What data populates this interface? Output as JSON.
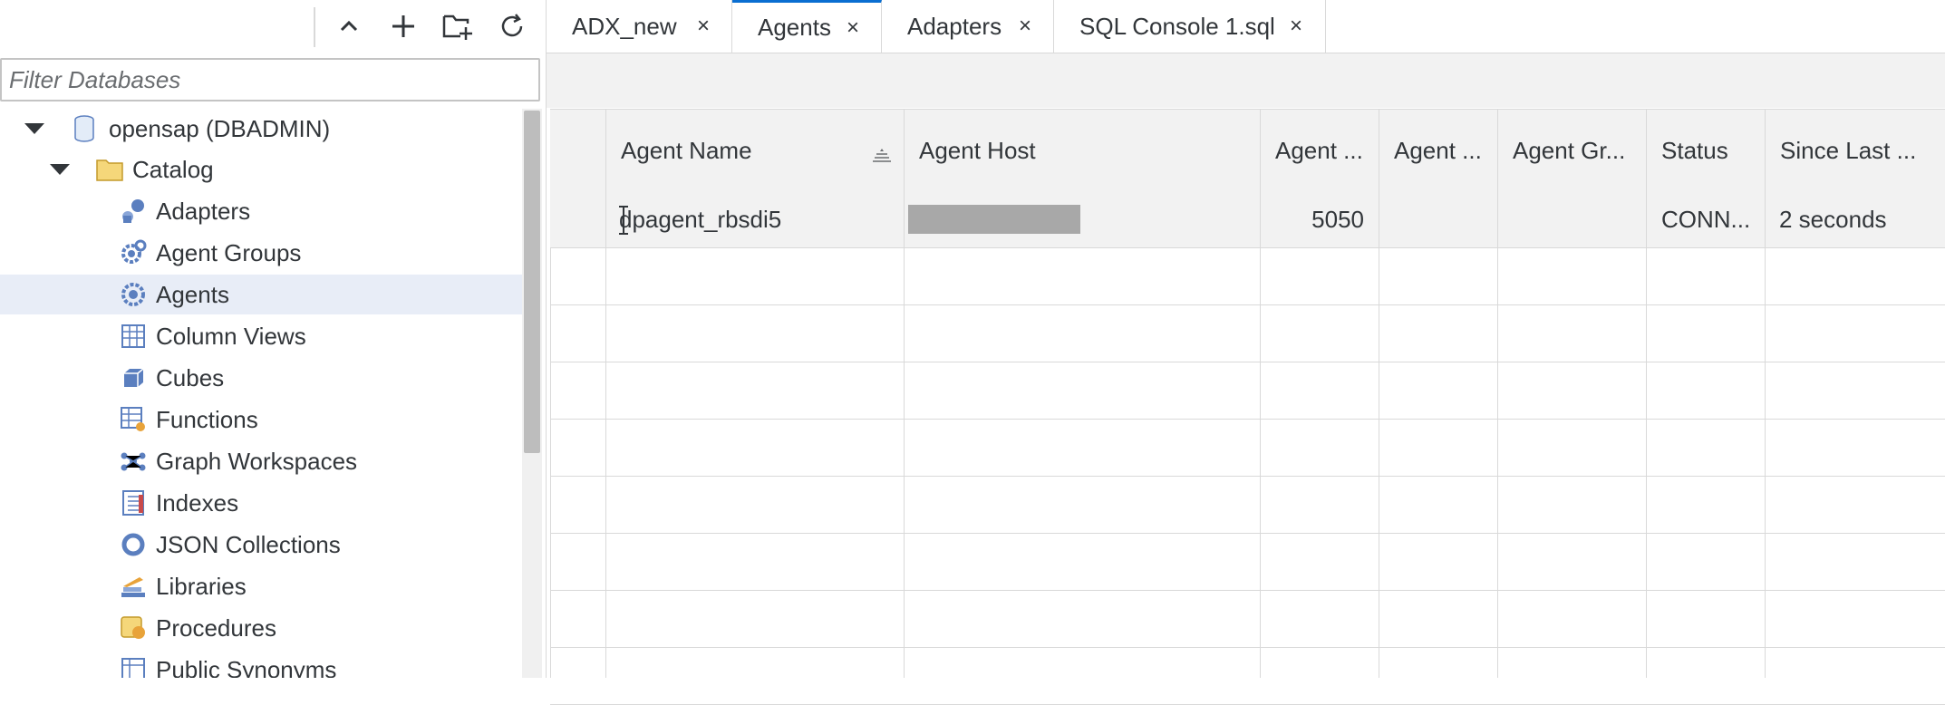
{
  "toolbar": {
    "buttons": [
      "collapse-all",
      "add-database",
      "add-folder",
      "refresh"
    ]
  },
  "filter": {
    "placeholder": "Filter Databases",
    "value": ""
  },
  "tree": {
    "root": "opensap (DBADMIN)",
    "catalog": "Catalog",
    "items": [
      "Adapters",
      "Agent Groups",
      "Agents",
      "Column Views",
      "Cubes",
      "Functions",
      "Graph Workspaces",
      "Indexes",
      "JSON Collections",
      "Libraries",
      "Procedures",
      "Public Synonyms"
    ],
    "selected": "Agents"
  },
  "tabs": [
    {
      "label": "ADX_new"
    },
    {
      "label": "Agents"
    },
    {
      "label": "Adapters"
    },
    {
      "label": "SQL Console 1.sql"
    }
  ],
  "active_tab": "Agents",
  "tab_close": "×",
  "grid": {
    "columns": [
      "Agent Name",
      "Agent Host",
      "Agent ...",
      "Agent ...",
      "Agent Gr...",
      "Status",
      "Since Last ..."
    ],
    "rows": [
      {
        "name": "dpagent_rbsdi5",
        "host": "",
        "port": "5050",
        "col4": "",
        "group": "",
        "status": "CONN...",
        "since": "2 seconds"
      }
    ],
    "sorted_column": "Agent Name"
  },
  "colors": {
    "accent": "#0a6ed1",
    "selection": "#e8edf7",
    "redacted": "#a8a8a8"
  }
}
